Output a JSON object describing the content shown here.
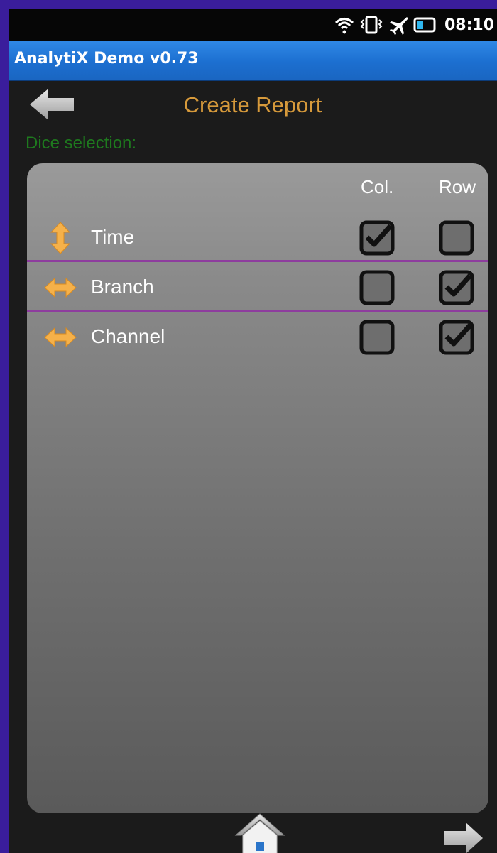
{
  "status_bar": {
    "time": "08:10",
    "icons": [
      "wifi-icon",
      "vibrate-icon",
      "airplane-icon",
      "battery-icon"
    ]
  },
  "app": {
    "title": "AnalytiX Demo v0.73"
  },
  "header": {
    "title": "Create Report",
    "back_icon": "back-arrow-icon"
  },
  "section": {
    "label": "Dice selection:"
  },
  "table": {
    "columns": {
      "col": "Col.",
      "row": "Row"
    },
    "rows": [
      {
        "label": "Time",
        "icon": "vertical-arrows-icon",
        "col": true,
        "row": false
      },
      {
        "label": "Branch",
        "icon": "horizontal-arrows-icon",
        "col": false,
        "row": true
      },
      {
        "label": "Channel",
        "icon": "horizontal-arrows-icon",
        "col": false,
        "row": true
      }
    ]
  },
  "footer": {
    "home_icon": "home-icon",
    "next_icon": "forward-arrow-icon"
  },
  "colors": {
    "background_frame": "#3a1d9c",
    "title_bar": "#1c6fd0",
    "page_title": "#d79a3b",
    "section_label": "#1e7a1e",
    "separator": "#8e3d9e",
    "arrow_icon": "#f5b14a"
  }
}
